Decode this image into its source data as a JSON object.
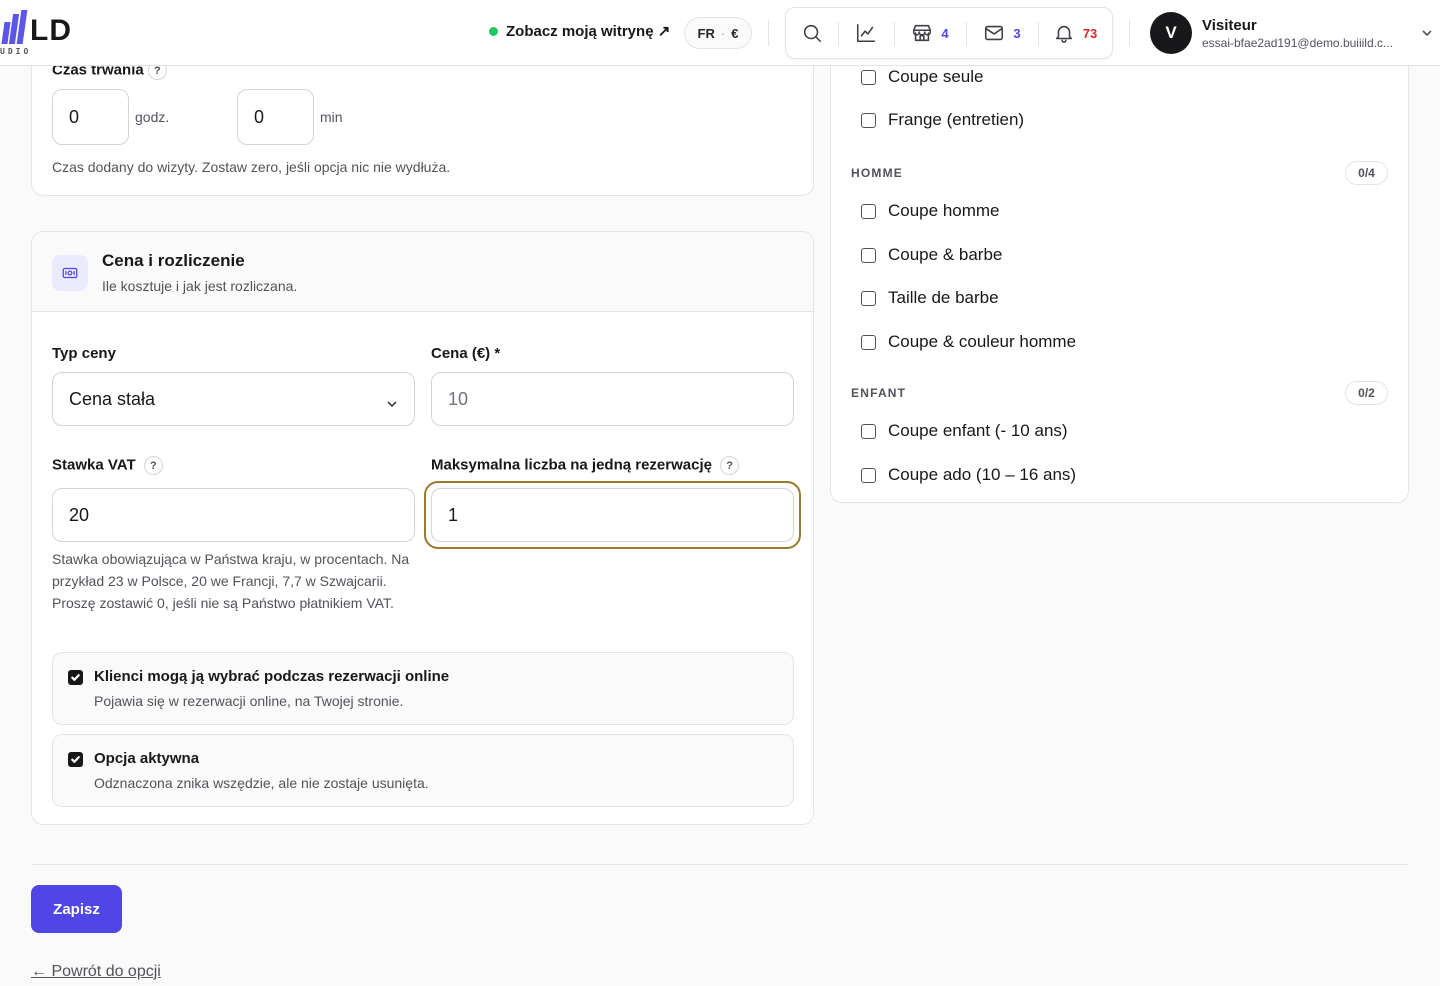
{
  "brand": {
    "logo_text": "LD",
    "logo_sub": "UDIO",
    "accent": "#4f46e5"
  },
  "header": {
    "site_link": "Zobacz moją witrynę ↗",
    "lang": "FR",
    "currency": "€",
    "icons": [
      "search-icon",
      "chart-icon",
      "store-icon",
      "mail-icon",
      "bell-icon"
    ],
    "store_count": "4",
    "mail_count": "3",
    "bell_count": "73"
  },
  "user": {
    "initial": "V",
    "name": "Visiteur",
    "email": "essai-bfae2ad191@demo.buiiild.c..."
  },
  "duration": {
    "label": "Czas trwania",
    "help_mark": "?",
    "hours_value": "0",
    "hours_unit": "godz.",
    "minutes_value": "0",
    "minutes_unit": "min",
    "help": "Czas dodany do wizyty. Zostaw zero, jeśli opcja nic nie wydłuża."
  },
  "price": {
    "title": "Cena i rozliczenie",
    "subtitle": "Ile kosztuje i jak jest rozliczana.",
    "type_label": "Typ ceny",
    "type_value": "Cena stała",
    "price_label": "Cena (€) *",
    "price_placeholder": "10",
    "vat_label": "Stawka VAT",
    "vat_help_mark": "?",
    "vat_value": "20",
    "max_label": "Maksymalna liczba na jedną rezerwację",
    "max_help_mark": "?",
    "max_value": "1",
    "vat_help": "Stawka obowiązująca w Państwa kraju, w procentach. Na przykład 23 w Polsce, 20 we Francji, 7,7 w Szwajcarii. Proszę zostawić 0, jeśli nie są Państwo płatnikiem VAT.",
    "online_title": "Klienci mogą ją wybrać podczas rezerwacji online",
    "online_sub": "Pojawia się w rezerwacji online, na Twojej stronie.",
    "active_title": "Opcja aktywna",
    "active_sub": "Odznaczona znika wszędzie, ale nie zostaje usunięta."
  },
  "categories": {
    "top_items": [
      "Coupe seule",
      "Frange (entretien)"
    ],
    "groups": [
      {
        "label": "HOMME",
        "count": "0/4",
        "items": [
          "Coupe homme",
          "Coupe & barbe",
          "Taille de barbe",
          "Coupe & couleur homme"
        ]
      },
      {
        "label": "ENFANT",
        "count": "0/2",
        "items": [
          "Coupe enfant (- 10 ans)",
          "Coupe ado (10 – 16 ans)"
        ]
      }
    ]
  },
  "footer": {
    "save": "Zapisz",
    "back": "← Powrót do opcji"
  }
}
